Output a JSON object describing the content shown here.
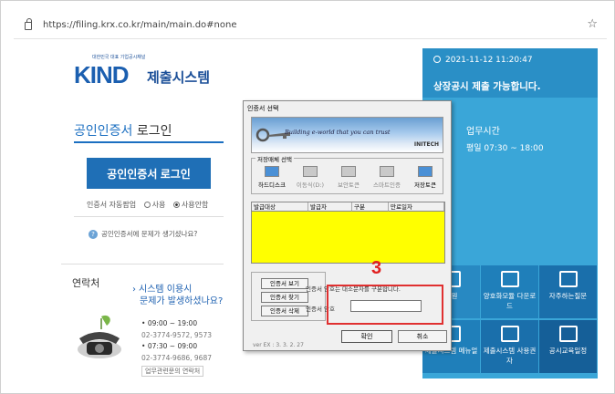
{
  "browser": {
    "url": "https://filing.krx.co.kr/main/main.do#none"
  },
  "logo": {
    "small": "대한민국 대표 기업공시채널",
    "kind": "KIND",
    "sys": "제출시스템"
  },
  "login": {
    "title_hl": "공인인증서",
    "title_rest": " 로그인",
    "button": "공인인증서 로그인",
    "autopop": "인증서 자동팝업",
    "opt_use": "사용",
    "opt_nouse": "사용안함",
    "help": "공인인증서에 문제가 생기셨나요?"
  },
  "contact": {
    "title": "연락처",
    "q1": "시스템 이용시",
    "q2": "문제가 발생하셨나요?",
    "t1": "09:00 ~ 19:00",
    "p1": "02-3774-9572, 9573",
    "t2": "07:30 ~ 09:00",
    "p2": "02-3774-9686, 9687",
    "btn": "업무관련문의 연락처"
  },
  "right": {
    "datetime": "2021-11-12  11:20:47",
    "avail": "상장공시 제출 가능합니다.",
    "hours_title": "업무시간",
    "hours": "평일 07:30 ~ 18:00",
    "tiles": [
      "지원",
      "양호화모듈 다운로드",
      "자주하는질문",
      "제출시스템 메뉴얼",
      "제출시스템 사용권자",
      "공시교육일정"
    ]
  },
  "dialog": {
    "title": "인증서 선택",
    "tagline": "Building e-world that you can trust",
    "brand": "INITECH",
    "media_label": "저장매체 선택",
    "media": [
      "하드디스크",
      "이동식(D:)",
      "보안토큰",
      "스마트인증",
      "저장토큰"
    ],
    "columns": [
      "발급대상",
      "발급자",
      "구분",
      "만료일자"
    ],
    "btn_view": "인증서 보기",
    "btn_find": "인증서 찾기",
    "btn_delete": "인증서 삭제",
    "warn": "인증서 암호는 대소문자를 구분합니다.",
    "pw_label": "인증서 암호",
    "version": "ver EX : 3. 3. 2. 27",
    "ok": "확인",
    "cancel": "취소"
  },
  "annotation": {
    "step": "3",
    "color": "#e03030"
  }
}
